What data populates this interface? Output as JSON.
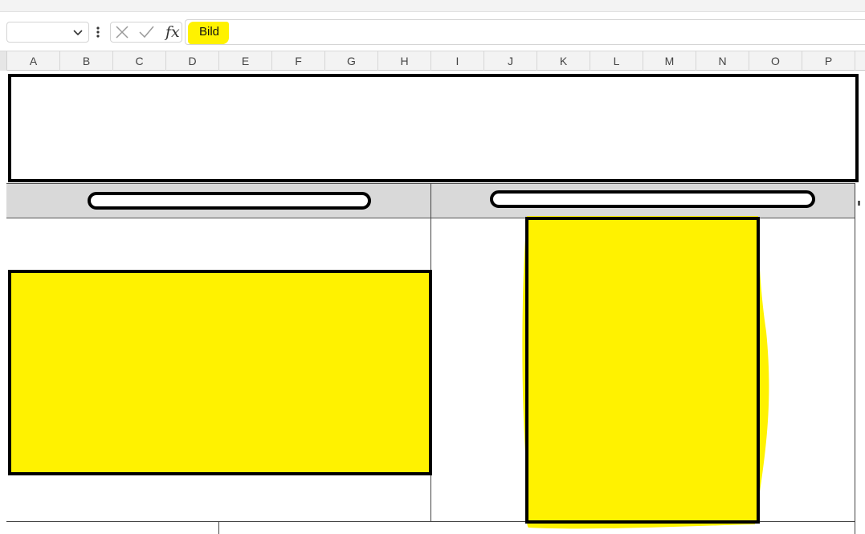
{
  "formula_bar": {
    "name_box_value": "",
    "name_box_icon": "chevron-down-icon",
    "more_icon": "vertical-ellipsis-icon",
    "cancel_icon": "close-icon",
    "enter_icon": "check-icon",
    "function_label": "fx",
    "content": "Bild",
    "highlight_color": "#fff200"
  },
  "columns": [
    "A",
    "B",
    "C",
    "D",
    "E",
    "F",
    "G",
    "H",
    "I",
    "J",
    "K",
    "L",
    "M",
    "N",
    "O",
    "P"
  ],
  "sheet": {
    "fill_color": "#fff200",
    "header_band_color": "#d9d9d9"
  }
}
